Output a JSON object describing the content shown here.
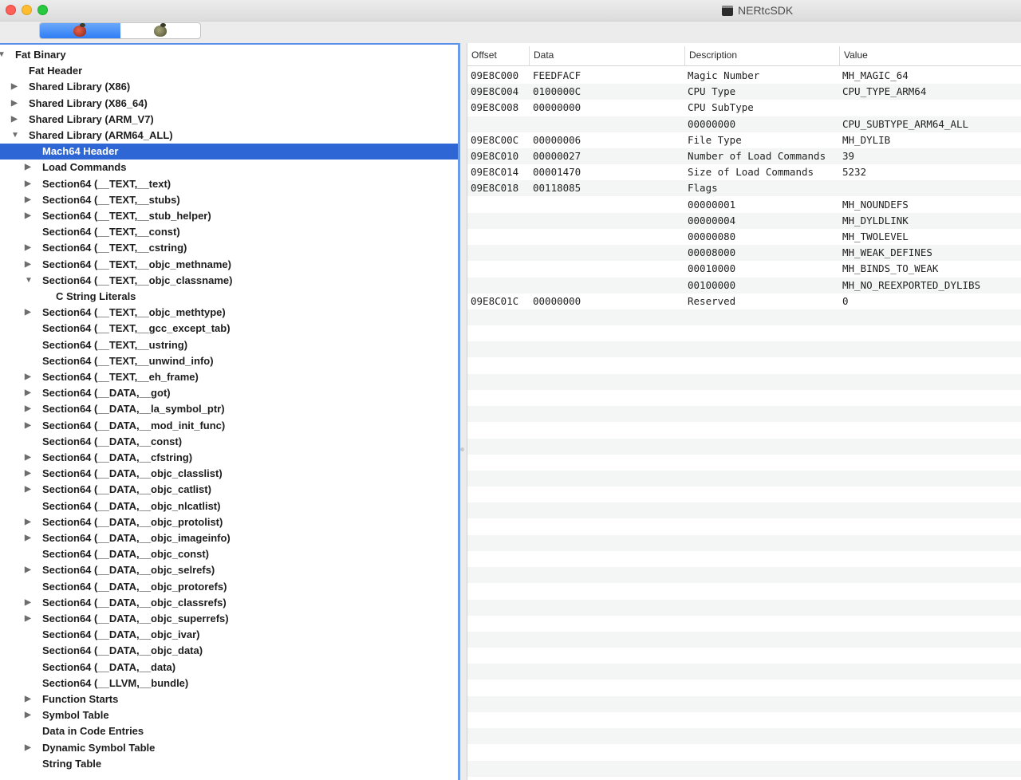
{
  "window": {
    "title": "NERtcSDK",
    "app_icon": "terminal-icon"
  },
  "toolbar": {
    "segments": [
      {
        "icon": "red-bug-icon",
        "active": true
      },
      {
        "icon": "green-bug-icon",
        "active": false
      }
    ]
  },
  "tree": {
    "items": [
      {
        "label": "Fat Binary",
        "expander": "open"
      },
      {
        "label": "Fat Header",
        "expander": "none"
      },
      {
        "label": "Shared Library  (X86)",
        "expander": "closed"
      },
      {
        "label": "Shared Library  (X86_64)",
        "expander": "closed"
      },
      {
        "label": "Shared Library  (ARM_V7)",
        "expander": "closed"
      },
      {
        "label": "Shared Library  (ARM64_ALL)",
        "expander": "open"
      },
      {
        "label": "Mach64 Header",
        "expander": "none",
        "selected": true
      },
      {
        "label": "Load Commands",
        "expander": "closed"
      },
      {
        "label": "Section64 (__TEXT,__text)",
        "expander": "closed"
      },
      {
        "label": "Section64 (__TEXT,__stubs)",
        "expander": "closed"
      },
      {
        "label": "Section64 (__TEXT,__stub_helper)",
        "expander": "closed"
      },
      {
        "label": "Section64 (__TEXT,__const)",
        "expander": "none"
      },
      {
        "label": "Section64 (__TEXT,__cstring)",
        "expander": "closed"
      },
      {
        "label": "Section64 (__TEXT,__objc_methname)",
        "expander": "closed"
      },
      {
        "label": "Section64 (__TEXT,__objc_classname)",
        "expander": "open"
      },
      {
        "label": "C String Literals",
        "expander": "none"
      },
      {
        "label": "Section64 (__TEXT,__objc_methtype)",
        "expander": "closed"
      },
      {
        "label": "Section64 (__TEXT,__gcc_except_tab)",
        "expander": "none"
      },
      {
        "label": "Section64 (__TEXT,__ustring)",
        "expander": "none"
      },
      {
        "label": "Section64 (__TEXT,__unwind_info)",
        "expander": "none"
      },
      {
        "label": "Section64 (__TEXT,__eh_frame)",
        "expander": "closed"
      },
      {
        "label": "Section64 (__DATA,__got)",
        "expander": "closed"
      },
      {
        "label": "Section64 (__DATA,__la_symbol_ptr)",
        "expander": "closed"
      },
      {
        "label": "Section64 (__DATA,__mod_init_func)",
        "expander": "closed"
      },
      {
        "label": "Section64 (__DATA,__const)",
        "expander": "none"
      },
      {
        "label": "Section64 (__DATA,__cfstring)",
        "expander": "closed"
      },
      {
        "label": "Section64 (__DATA,__objc_classlist)",
        "expander": "closed"
      },
      {
        "label": "Section64 (__DATA,__objc_catlist)",
        "expander": "closed"
      },
      {
        "label": "Section64 (__DATA,__objc_nlcatlist)",
        "expander": "none"
      },
      {
        "label": "Section64 (__DATA,__objc_protolist)",
        "expander": "closed"
      },
      {
        "label": "Section64 (__DATA,__objc_imageinfo)",
        "expander": "closed"
      },
      {
        "label": "Section64 (__DATA,__objc_const)",
        "expander": "none"
      },
      {
        "label": "Section64 (__DATA,__objc_selrefs)",
        "expander": "closed"
      },
      {
        "label": "Section64 (__DATA,__objc_protorefs)",
        "expander": "none"
      },
      {
        "label": "Section64 (__DATA,__objc_classrefs)",
        "expander": "closed"
      },
      {
        "label": "Section64 (__DATA,__objc_superrefs)",
        "expander": "closed"
      },
      {
        "label": "Section64 (__DATA,__objc_ivar)",
        "expander": "none"
      },
      {
        "label": "Section64 (__DATA,__objc_data)",
        "expander": "none"
      },
      {
        "label": "Section64 (__DATA,__data)",
        "expander": "none"
      },
      {
        "label": "Section64 (__LLVM,__bundle)",
        "expander": "none"
      },
      {
        "label": "Function Starts",
        "expander": "closed"
      },
      {
        "label": "Symbol Table",
        "expander": "closed"
      },
      {
        "label": "Data in Code Entries",
        "expander": "none"
      },
      {
        "label": "Dynamic Symbol Table",
        "expander": "closed"
      },
      {
        "label": "String Table",
        "expander": "none"
      }
    ]
  },
  "table": {
    "headers": [
      "Offset",
      "Data",
      "Description",
      "Value"
    ],
    "rows": [
      [
        "09E8C000",
        "FEEDFACF",
        "Magic Number",
        "MH_MAGIC_64"
      ],
      [
        "09E8C004",
        "0100000C",
        "CPU Type",
        "CPU_TYPE_ARM64"
      ],
      [
        "09E8C008",
        "00000000",
        "CPU SubType",
        ""
      ],
      [
        "",
        "",
        "00000000",
        "CPU_SUBTYPE_ARM64_ALL"
      ],
      [
        "09E8C00C",
        "00000006",
        "File Type",
        "MH_DYLIB"
      ],
      [
        "09E8C010",
        "00000027",
        "Number of Load Commands",
        "39"
      ],
      [
        "09E8C014",
        "00001470",
        "Size of Load Commands",
        "5232"
      ],
      [
        "09E8C018",
        "00118085",
        "Flags",
        ""
      ],
      [
        "",
        "",
        "00000001",
        "MH_NOUNDEFS"
      ],
      [
        "",
        "",
        "00000004",
        "MH_DYLDLINK"
      ],
      [
        "",
        "",
        "00000080",
        "MH_TWOLEVEL"
      ],
      [
        "",
        "",
        "00008000",
        "MH_WEAK_DEFINES"
      ],
      [
        "",
        "",
        "00010000",
        "MH_BINDS_TO_WEAK"
      ],
      [
        "",
        "",
        "00100000",
        "MH_NO_REEXPORTED_DYLIBS"
      ],
      [
        "09E8C01C",
        "00000000",
        "Reserved",
        "0"
      ]
    ]
  }
}
